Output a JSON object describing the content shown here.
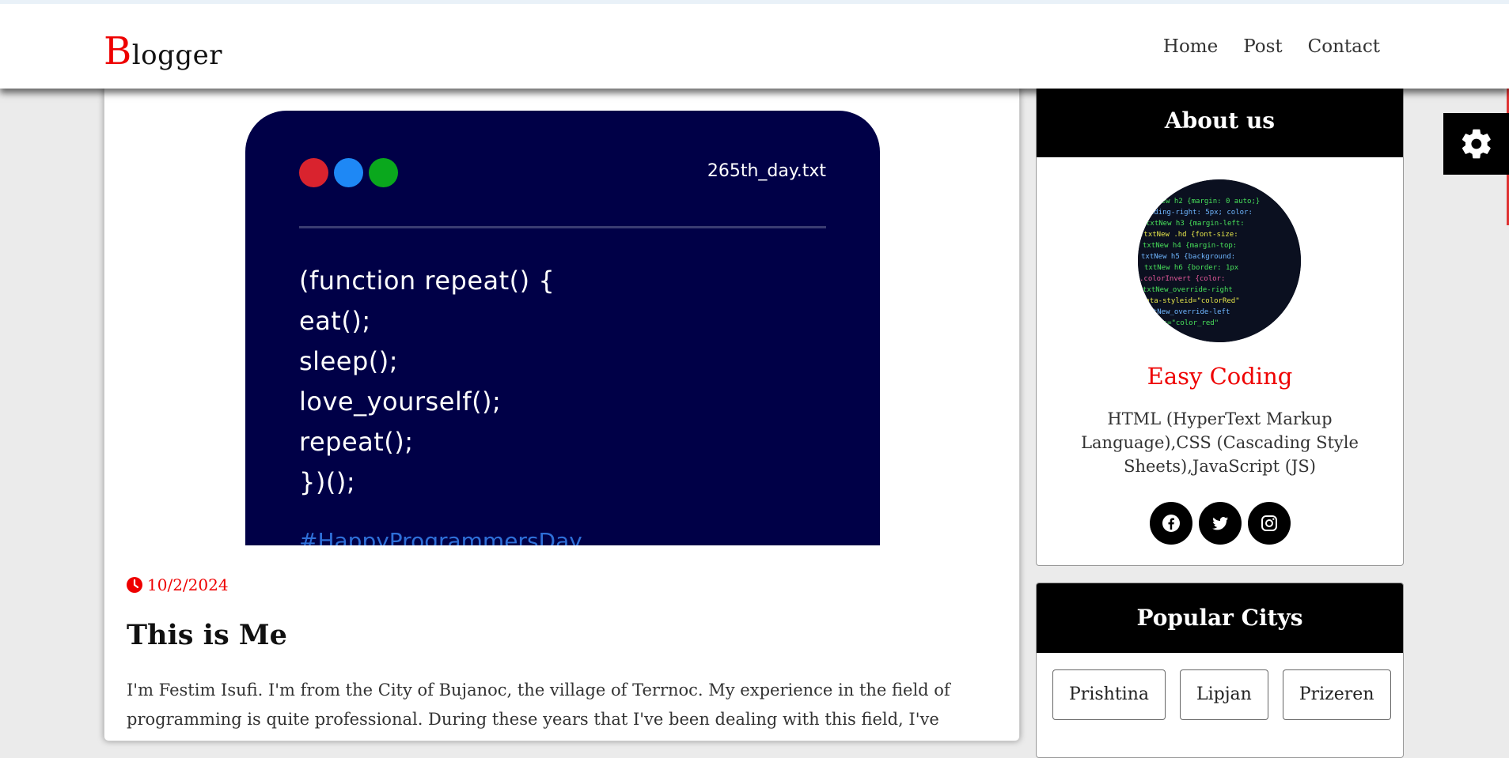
{
  "header": {
    "logo_initial": "B",
    "logo_rest": "logger",
    "nav": [
      "Home",
      "Post",
      "Contact"
    ]
  },
  "post": {
    "image": {
      "filename": "265th_day.txt",
      "dot_colors": [
        "#d9232e",
        "#1e88f5",
        "#0aa81d"
      ],
      "code": [
        "(function repeat() {",
        "eat();",
        "sleep();",
        "love_yourself();",
        "repeat();",
        "})();"
      ],
      "hashtag": "#HappyProgrammersDay"
    },
    "date": "10/2/2024",
    "title": "This is Me",
    "body": "I'm Festim Isufi. I'm from the City of Bujanoc, the village of Terrnoc. My experience in the field of programming is quite professional. During these years that I've been dealing with this field, I've"
  },
  "sidebar": {
    "about": {
      "heading": "About us",
      "name": "Easy Coding",
      "description": "HTML (HyperText Markup Language),CSS (Cascading Style Sheets),JavaScript (JS)",
      "socials": [
        "facebook-icon",
        "twitter-icon",
        "instagram-icon"
      ]
    },
    "cities": {
      "heading": "Popular Citys",
      "items": [
        "Prishtina",
        "Lipjan",
        "Prizeren"
      ]
    }
  },
  "colors": {
    "accent": "#ee0000",
    "code_bg": "#000047"
  }
}
